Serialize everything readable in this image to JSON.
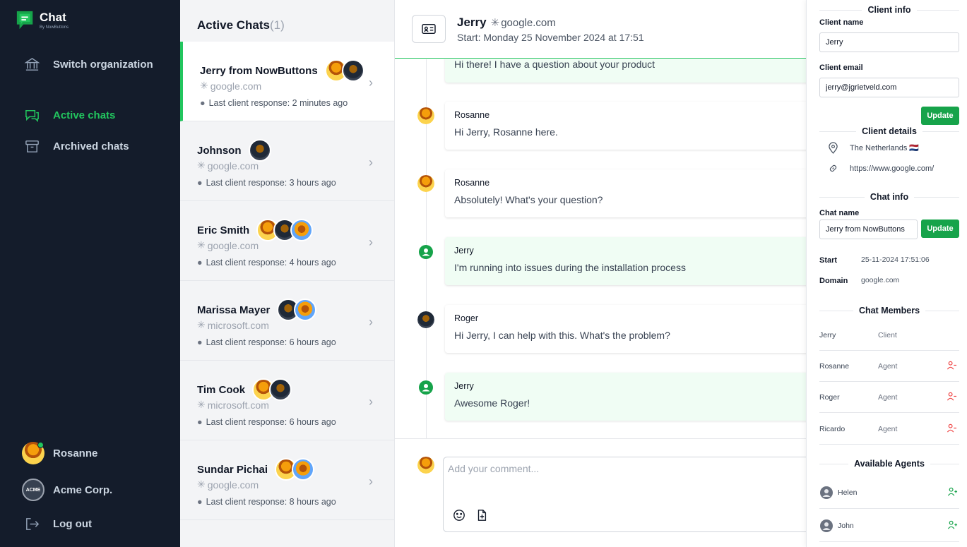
{
  "app": {
    "name": "Chat",
    "subtitle": "By NowButtons"
  },
  "sidebar": {
    "items": [
      {
        "label": "Switch organization",
        "icon": "bank-icon"
      },
      {
        "label": "Active chats",
        "icon": "chat-bubbles-icon",
        "active": true
      },
      {
        "label": "Archived chats",
        "icon": "archive-box-icon"
      }
    ],
    "user": {
      "name": "Rosanne"
    },
    "organization": {
      "name": "Acme Corp.",
      "logo_text": "ACME"
    },
    "logout": {
      "label": "Log out"
    }
  },
  "chatlist": {
    "title": "Active Chats",
    "count": "(1)",
    "chats": [
      {
        "name": "Jerry from NowButtons",
        "domain": "google.com",
        "response": "Last client response: 2 minutes ago"
      },
      {
        "name": "Johnson",
        "domain": "google.com",
        "response": "Last client response: 3 hours ago"
      },
      {
        "name": "Eric Smith",
        "domain": "google.com",
        "response": "Last client response: 4 hours ago"
      },
      {
        "name": "Marissa Mayer",
        "domain": "microsoft.com",
        "response": "Last client response: 6 hours ago"
      },
      {
        "name": "Tim Cook",
        "domain": "microsoft.com",
        "response": "Last client response: 6 hours ago"
      },
      {
        "name": "Sundar Pichai",
        "domain": "google.com",
        "response": "Last client response: 8 hours ago"
      }
    ]
  },
  "conversation": {
    "client_name": "Jerry",
    "domain": "google.com",
    "start": "Start: Monday 25 November 2024 at 17:51",
    "messages": [
      {
        "author": "",
        "text": "Hi there! I have a question about your product",
        "type": "client"
      },
      {
        "author": "Rosanne",
        "text": "Hi Jerry, Rosanne here.",
        "type": "agent"
      },
      {
        "author": "Rosanne",
        "text": "Absolutely! What's your question?",
        "type": "agent"
      },
      {
        "author": "Jerry",
        "text": "I'm running into issues during the installation process",
        "type": "client"
      },
      {
        "author": "Roger",
        "text": "Hi Jerry, I can help with this. What's the problem?",
        "type": "agent"
      },
      {
        "author": "Jerry",
        "text": "Awesome Roger!",
        "type": "client"
      }
    ],
    "composer_placeholder": "Add your comment..."
  },
  "panel": {
    "client_info": {
      "title": "Client info",
      "name_label": "Client name",
      "name_value": "Jerry",
      "email_label": "Client email",
      "email_value": "jerry@jgrietveld.com",
      "update_label": "Update"
    },
    "client_details": {
      "title": "Client details",
      "country": "The Netherlands 🇳🇱",
      "url": "https://www.google.com/"
    },
    "chat_info": {
      "title": "Chat info",
      "chat_name_label": "Chat name",
      "chat_name_value": "Jerry from NowButtons",
      "update_label": "Update",
      "start_label": "Start",
      "start_value": "25-11-2024 17:51:06",
      "domain_label": "Domain",
      "domain_value": "google.com"
    },
    "members": {
      "title": "Chat Members",
      "list": [
        {
          "name": "Jerry",
          "role": "Client"
        },
        {
          "name": "Rosanne",
          "role": "Agent"
        },
        {
          "name": "Roger",
          "role": "Agent"
        },
        {
          "name": "Ricardo",
          "role": "Agent"
        }
      ]
    },
    "agents": {
      "title": "Available Agents",
      "list": [
        {
          "name": "Helen"
        },
        {
          "name": "John"
        }
      ]
    }
  },
  "colors": {
    "accent": "#16a34a",
    "sidebar": "#141c2b",
    "danger": "#ef4444"
  }
}
